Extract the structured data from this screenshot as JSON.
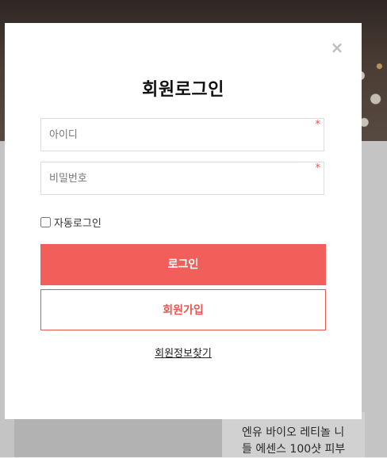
{
  "modal": {
    "title": "회원로그인",
    "close_icon": "×",
    "id_placeholder": "아이디",
    "pw_placeholder": "비밀번호",
    "required_mark": "*",
    "auto_login_label": "자동로그인",
    "login_button": "로그인",
    "join_button": "회원가입",
    "find_account_link": "회원정보찾기"
  },
  "background": {
    "product_title_line1": "엔유 바이오 레티놀 니",
    "product_title_line2": "들 에센스 100샷 피부"
  },
  "colors": {
    "accent": "#f25e5a",
    "required": "#e05555"
  }
}
